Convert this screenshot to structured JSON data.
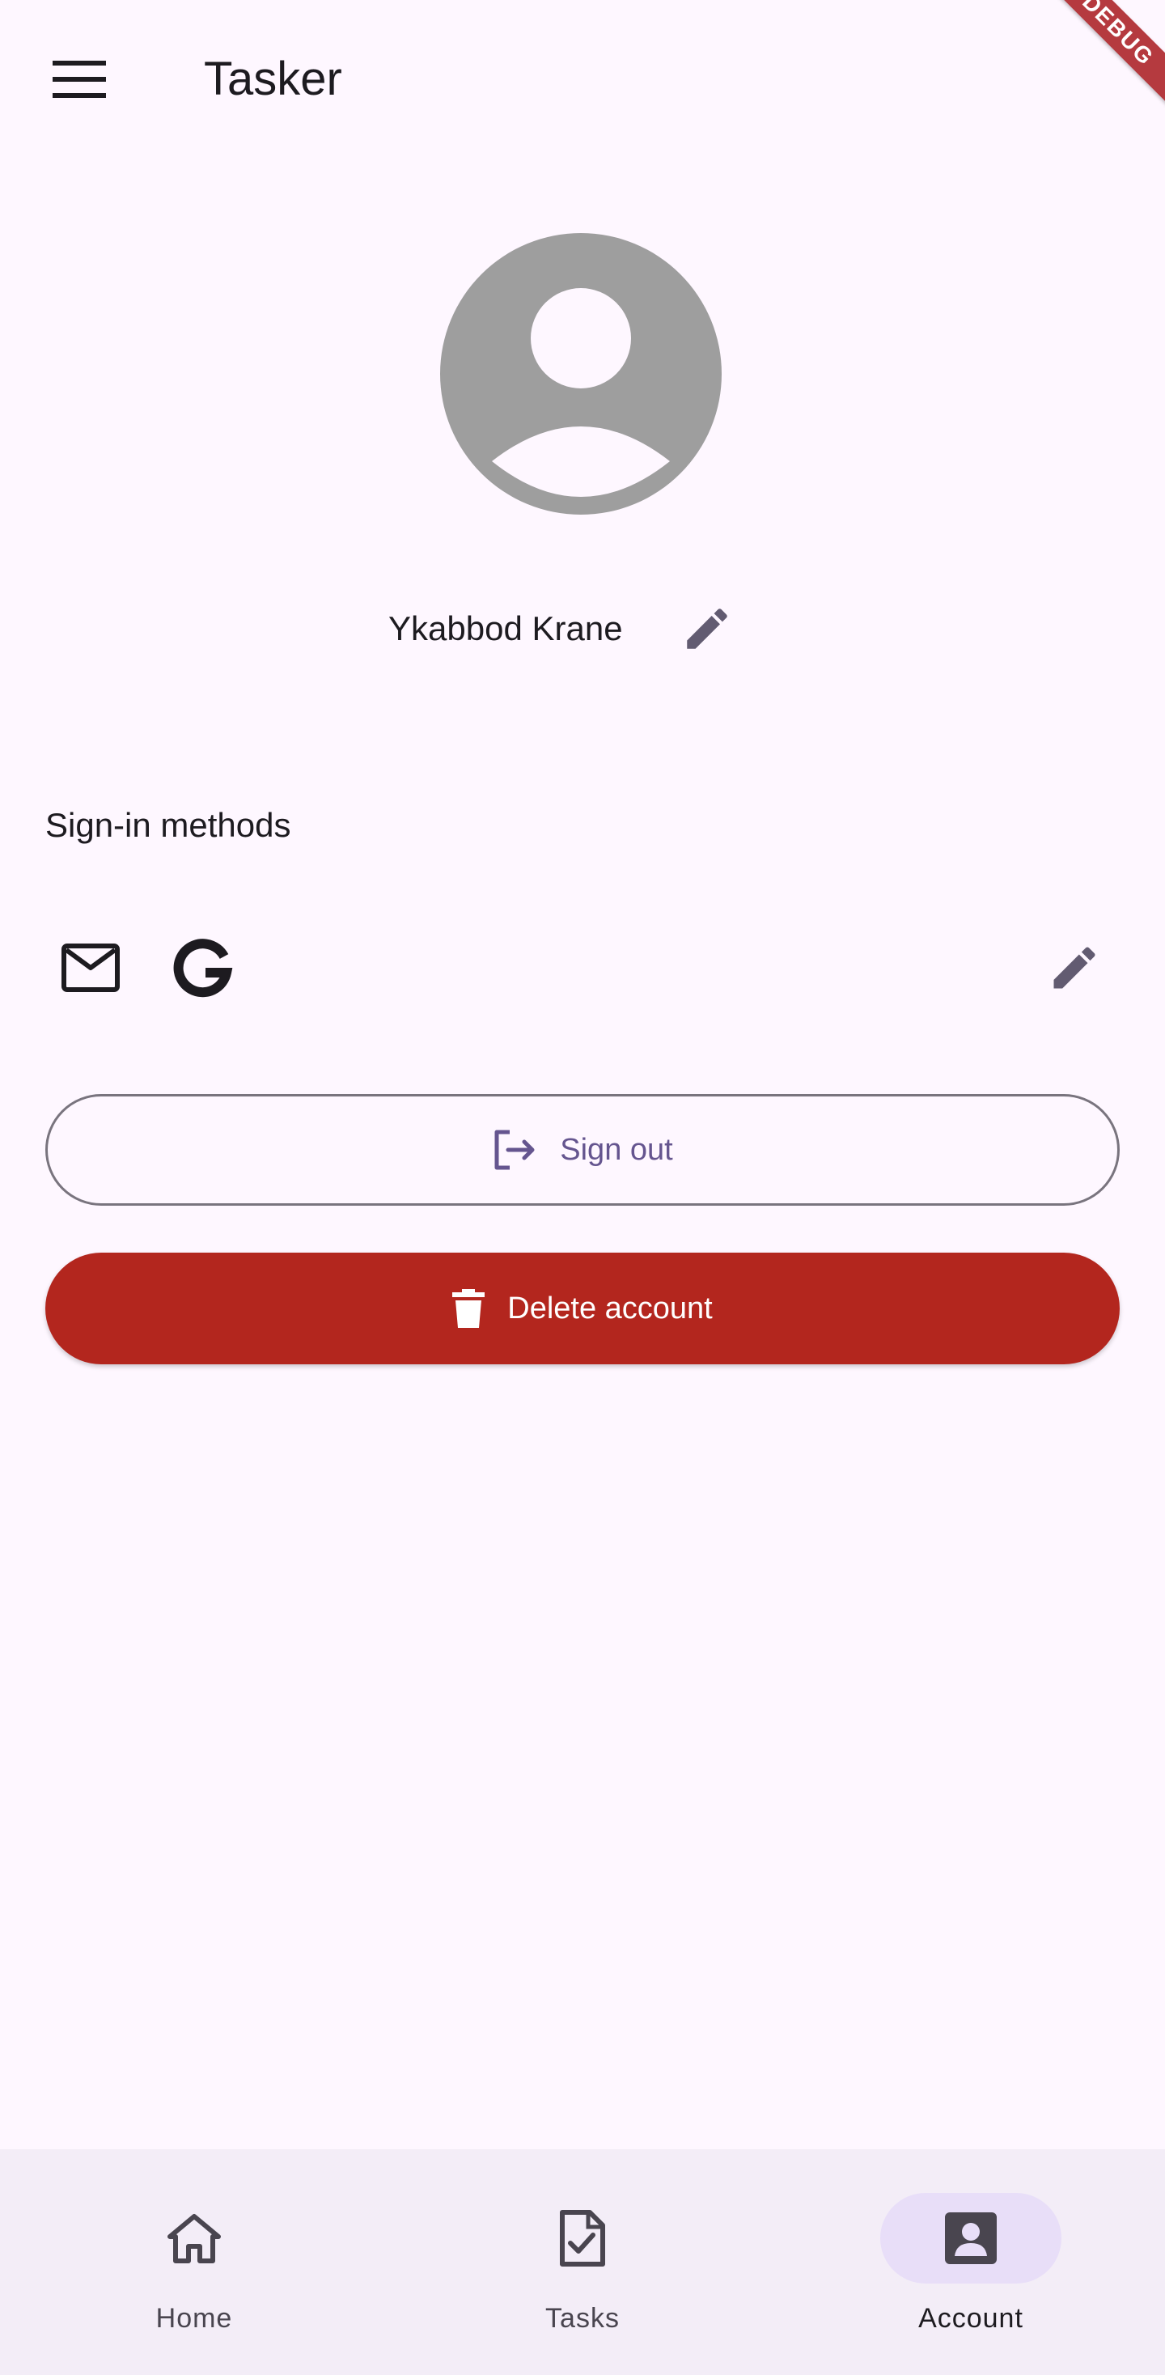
{
  "app_bar": {
    "title": "Tasker",
    "menu_icon": "menu-icon"
  },
  "debug_banner": {
    "text": "DEBUG"
  },
  "profile": {
    "avatar_icon": "account-circle-icon",
    "name": "Ykabbod Krane",
    "edit_icon": "edit-icon"
  },
  "sign_in_methods": {
    "title": "Sign-in methods",
    "methods": [
      "email-icon",
      "google-icon"
    ],
    "edit_icon": "edit-icon"
  },
  "actions": {
    "sign_out_label": "Sign out",
    "sign_out_icon": "logout-icon",
    "delete_label": "Delete account",
    "delete_icon": "trash-icon"
  },
  "bottom_nav": {
    "items": [
      {
        "label": "Home",
        "icon": "home-icon",
        "selected": false
      },
      {
        "label": "Tasks",
        "icon": "task-icon",
        "selected": false
      },
      {
        "label": "Account",
        "icon": "account-box-icon",
        "selected": true
      }
    ]
  },
  "colors": {
    "background": "#fef7ff",
    "primary": "#65558f",
    "error": "#b3261e",
    "nav_background": "#f3edf7",
    "nav_indicator": "#e8def8"
  }
}
